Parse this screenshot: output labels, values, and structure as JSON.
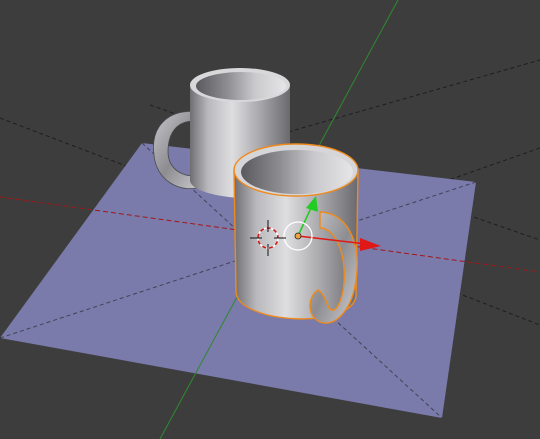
{
  "viewport": {
    "background_color": "#3d3d3d",
    "ground_plane_color": "#7a7aab",
    "grid_line_color": "#1e1e1e",
    "x_axis_color": "#a01818",
    "y_axis_color": "#2f8a2f",
    "selection_outline_color": "#ee8a1e",
    "manipulator": {
      "x_arrow_color": "#e01818",
      "y_arrow_color": "#22cc22",
      "center_icon": "transform-manipulator-center-icon"
    },
    "cursor_icon": "3d-cursor-icon",
    "objects": [
      {
        "name": "mug",
        "selected": false
      },
      {
        "name": "mug",
        "selected": true
      },
      {
        "name": "plane",
        "selected": false
      }
    ]
  }
}
